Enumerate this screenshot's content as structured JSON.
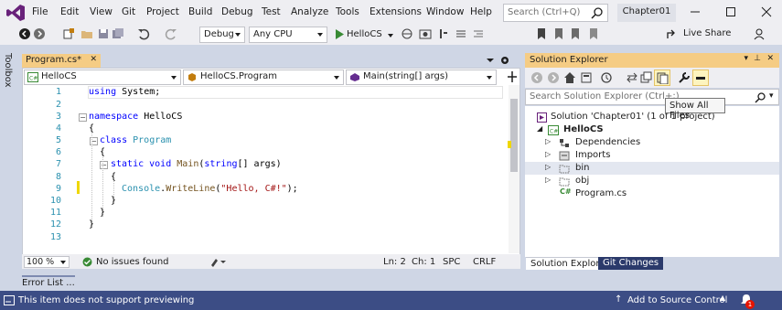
{
  "menubar": {
    "items": [
      "File",
      "Edit",
      "View",
      "Git",
      "Project",
      "Build",
      "Debug",
      "Test",
      "Analyze",
      "Tools",
      "Extensions",
      "Window",
      "Help"
    ],
    "search_placeholder": "Search (Ctrl+Q)",
    "solution_name": "Chapter01"
  },
  "toolbar": {
    "config": "Debug",
    "platform": "Any CPU",
    "run_target": "HelloCS",
    "live_share": "Live Share"
  },
  "toolbox": {
    "label": "Toolbox"
  },
  "editor": {
    "tab_label": "Program.cs*",
    "nav": {
      "project": "HelloCS",
      "class": "HelloCS.Program",
      "member": "Main(string[] args)"
    },
    "lines": [
      "1",
      "2",
      "3",
      "4",
      "5",
      "6",
      "7",
      "8",
      "9",
      "10",
      "11",
      "12",
      "13"
    ],
    "code": {
      "l1_kw": "using",
      "l1_rest": " System;",
      "l3_kw": "namespace",
      "l3_rest": " HelloCS",
      "l4": "{",
      "l5_kw": "class",
      "l5_name": " Program",
      "l6": "{",
      "l7_kw1": "static",
      "l7_kw2": " void",
      "l7_method": " Main",
      "l7_open": "(",
      "l7_kw3": "string",
      "l7_rest": "[] args)",
      "l8": "{",
      "l9_type": "Console",
      "l9_dot": ".",
      "l9_method": "WriteLine",
      "l9_open": "(",
      "l9_str": "\"Hello, C#!\"",
      "l9_close": ");",
      "l10": "}",
      "l11": "}",
      "l12": "}"
    },
    "status": {
      "zoom": "100 %",
      "issues": "No issues found",
      "ln": "Ln: 2",
      "ch": "Ch: 1",
      "spc": "SPC",
      "crlf": "CRLF"
    }
  },
  "solution_explorer": {
    "title": "Solution Explorer",
    "search_placeholder": "Search Solution Explorer (Ctrl+;)",
    "tooltip": "Show All Files",
    "tree": [
      {
        "label": "Solution 'Chapter01' (1 of 1 project)"
      },
      {
        "label": "HelloCS"
      },
      {
        "label": "Dependencies"
      },
      {
        "label": "Imports"
      },
      {
        "label": "bin"
      },
      {
        "label": "obj"
      },
      {
        "label": "Program.cs"
      }
    ],
    "tabs": [
      "Solution Explorer",
      "Git Changes"
    ]
  },
  "bottom": {
    "error_list": "Error List ...",
    "status_text": "This item does not support previewing",
    "source_control": "Add to Source Control",
    "notif_count": "1"
  },
  "colors": {
    "accent": "#f5cc84",
    "status_bar": "#3c4d85",
    "vs_purple": "#68217a"
  }
}
